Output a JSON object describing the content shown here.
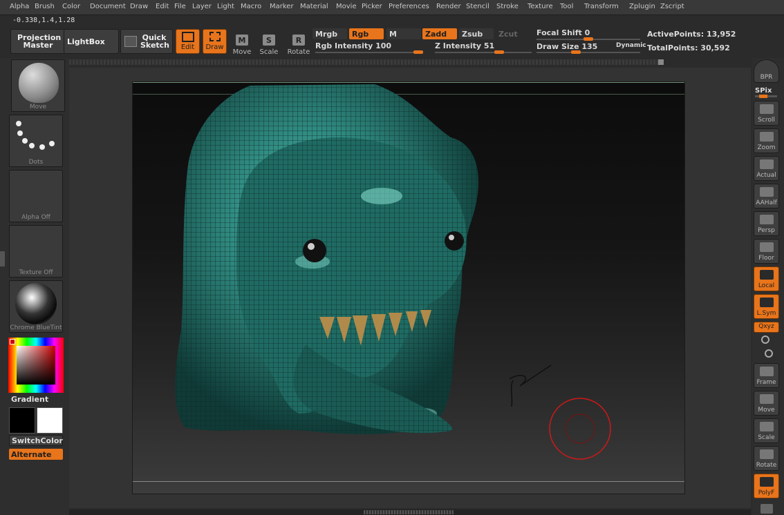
{
  "menu": [
    "Alpha",
    "Brush",
    "Color",
    "Document",
    "Draw",
    "Edit",
    "File",
    "Layer",
    "Light",
    "Macro",
    "Marker",
    "Material",
    "Movie",
    "Picker",
    "Preferences",
    "Render",
    "Stencil",
    "Stroke",
    "Texture",
    "Tool",
    "Transform",
    "Zplugin",
    "Zscript"
  ],
  "coords": "-0.338,1.4,1.28",
  "toolbar": {
    "projection_master": "Projection Master",
    "lightbox": "LightBox",
    "quick_sketch": "Quick Sketch",
    "edit": "Edit",
    "draw": "Draw",
    "move": "Move",
    "scale": "Scale",
    "rotate": "Rotate",
    "move_key": "M",
    "scale_key": "S",
    "rotate_key": "R",
    "mrgb": "Mrgb",
    "rgb": "Rgb",
    "m": "M",
    "zadd": "Zadd",
    "zsub": "Zsub",
    "zcut": "Zcut",
    "rgb_intensity": "Rgb Intensity 100",
    "z_intensity": "Z Intensity 51",
    "focal_shift": "Focal Shift 0",
    "draw_size": "Draw Size 135",
    "dynamic": "Dynamic",
    "active_points": "ActivePoints: 13,952",
    "total_points": "TotalPoints: 30,592"
  },
  "sliders": {
    "rgb_intensity": 1.0,
    "z_intensity": 0.51,
    "focal_shift": 0.5,
    "draw_size": 0.135
  },
  "left_shelf": {
    "brush_label": "Move",
    "stroke_label": "Dots",
    "alpha_label": "Alpha Off",
    "texture_label": "Texture Off",
    "material_label": "Chrome BlueTint",
    "gradient_label": "Gradient",
    "switchcolor_label": "SwitchColor",
    "alternate_label": "Alternate"
  },
  "right_shelf": {
    "bpr": "BPR",
    "spix": "SPix",
    "scroll": "Scroll",
    "zoom": "Zoom",
    "actual": "Actual",
    "aahalf": "AAHalf",
    "persp": "Persp",
    "floor": "Floor",
    "local": "Local",
    "lsym": "L.Sym",
    "xyz": "Qxyz",
    "frame": "Frame",
    "move": "Move",
    "scale": "Scale",
    "rotate": "Rotate",
    "polyf": "PolyF"
  },
  "colors": {
    "accent": "#e8741b",
    "mesh": "#2a7a72"
  }
}
